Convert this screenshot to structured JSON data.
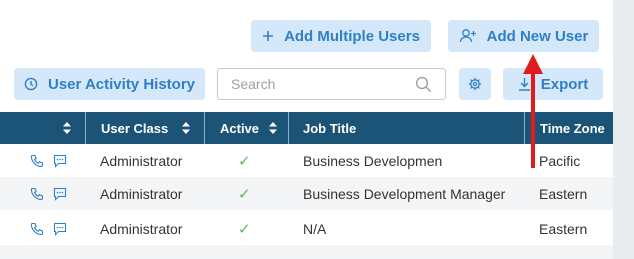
{
  "toolbar": {
    "add_multiple_users_label": "Add Multiple Users",
    "add_new_user_label": "Add New User",
    "user_activity_history_label": "User Activity History",
    "search_placeholder": "Search",
    "export_label": "Export"
  },
  "table": {
    "columns": [
      "User Class",
      "Active",
      "Job Title",
      "Time Zone"
    ],
    "rows": [
      {
        "user_class": "Administrator",
        "active": "✓",
        "job_title": "Business Developmen",
        "time_zone": "Pacific"
      },
      {
        "user_class": "Administrator",
        "active": "✓",
        "job_title": "Business Development Manager",
        "time_zone": "Eastern"
      },
      {
        "user_class": "Administrator",
        "active": "✓",
        "job_title": "N/A",
        "time_zone": "Eastern"
      }
    ]
  },
  "colors": {
    "accent": "#2f80c7",
    "button_bg": "#d5e8f9",
    "header_bg": "#1c5477",
    "check": "#5cb85c",
    "annotation_arrow": "#e01b1b"
  },
  "icons": [
    "plus-icon",
    "add-user-icon",
    "clock-icon",
    "search-icon",
    "gear-icon",
    "download-icon",
    "phone-icon",
    "chat-icon",
    "sort-icon",
    "check-icon"
  ]
}
